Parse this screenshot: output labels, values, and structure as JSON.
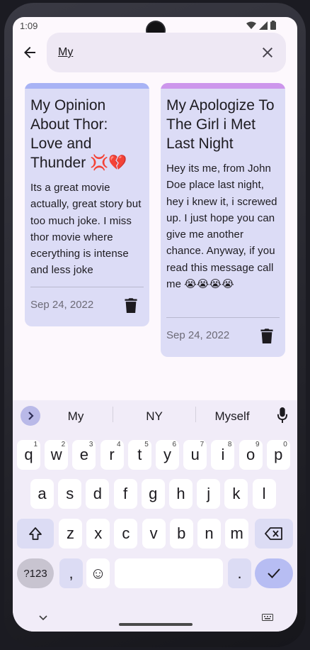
{
  "status_bar": {
    "time": "1:09"
  },
  "search": {
    "value": "My"
  },
  "notes": [
    {
      "title": "My Opinion About Thor: Love and Thunder 💢💔",
      "body": "Its a great movie actually, great story but too much joke. I miss thor movie where ecerything is intense and less joke",
      "date": "Sep 24, 2022",
      "accent_color": "#a8b3f5"
    },
    {
      "title": "My Apologize To The Girl i Met Last Night",
      "body": "Hey its me, from John Doe place last night, hey i knew it, i screwed up. I just hope you can give me another chance. Anyway, if you read this message call me 😭😭😭😭",
      "date": "Sep 24, 2022",
      "accent_color": "#cd96ec"
    }
  ],
  "keyboard": {
    "suggestions": [
      "My",
      "NY",
      "Myself"
    ],
    "row1": [
      {
        "k": "q",
        "n": "1"
      },
      {
        "k": "w",
        "n": "2"
      },
      {
        "k": "e",
        "n": "3"
      },
      {
        "k": "r",
        "n": "4"
      },
      {
        "k": "t",
        "n": "5"
      },
      {
        "k": "y",
        "n": "6"
      },
      {
        "k": "u",
        "n": "7"
      },
      {
        "k": "i",
        "n": "8"
      },
      {
        "k": "o",
        "n": "9"
      },
      {
        "k": "p",
        "n": "0"
      }
    ],
    "row2": [
      "a",
      "s",
      "d",
      "f",
      "g",
      "h",
      "j",
      "k",
      "l"
    ],
    "row3": [
      "z",
      "x",
      "c",
      "v",
      "b",
      "n",
      "m"
    ],
    "symbols_label": "?123",
    "comma": ",",
    "period": ".",
    "emoji": "☺"
  },
  "icons": {
    "back": "arrow-back-icon",
    "clear": "close-icon",
    "delete": "trash-icon",
    "suggestions_toggle": "chevron-right-icon",
    "mic": "microphone-icon",
    "shift": "shift-icon",
    "backspace": "backspace-icon",
    "enter": "check-icon"
  }
}
